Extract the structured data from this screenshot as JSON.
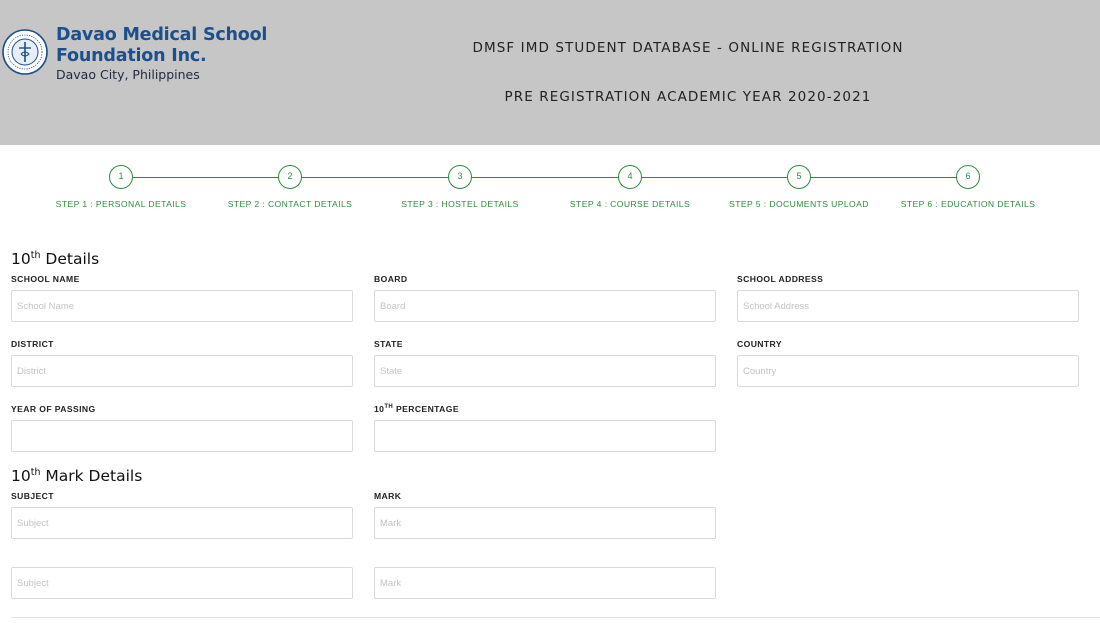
{
  "header": {
    "logo_line1": "Davao Medical School",
    "logo_line2": "Foundation Inc.",
    "logo_line3": "Davao City, Philippines",
    "title": "DMSF IMD STUDENT DATABASE - ONLINE REGISTRATION",
    "subtitle": "PRE REGISTRATION ACADEMIC YEAR 2020-2021",
    "logo_icon": "school-seal-icon",
    "bg_color": "#c6c6c6",
    "brand_color": "#1c4f8c"
  },
  "stepper": {
    "accent_color": "#2e8b3c",
    "steps": [
      {
        "number": "1",
        "label": "STEP 1 : PERSONAL DETAILS"
      },
      {
        "number": "2",
        "label": "STEP 2 : CONTACT DETAILS"
      },
      {
        "number": "3",
        "label": "STEP 3 : HOSTEL DETAILS"
      },
      {
        "number": "4",
        "label": "STEP 4 : COURSE DETAILS"
      },
      {
        "number": "5",
        "label": "STEP 5 : DOCUMENTS UPLOAD"
      },
      {
        "number": "6",
        "label": "STEP 6 : EDUCATION DETAILS"
      }
    ]
  },
  "tenth_details": {
    "title_num": "10",
    "title_sup": "th",
    "title_rest": " Details",
    "school_name": {
      "label": "SCHOOL NAME",
      "placeholder": "School Name",
      "value": ""
    },
    "board": {
      "label": "BOARD",
      "placeholder": "Board",
      "value": ""
    },
    "school_address": {
      "label": "SCHOOL ADDRESS",
      "placeholder": "School Address",
      "value": ""
    },
    "district": {
      "label": "DISTRICT",
      "placeholder": "District",
      "value": ""
    },
    "state": {
      "label": "STATE",
      "placeholder": "State",
      "value": ""
    },
    "country": {
      "label": "COUNTRY",
      "placeholder": "Country",
      "value": ""
    },
    "year_of_passing": {
      "label": "YEAR OF PASSING",
      "placeholder": "",
      "value": ""
    },
    "percentage": {
      "label_num": "10",
      "label_sup": "TH",
      "label_rest": " PERCENTAGE",
      "placeholder": "",
      "value": ""
    }
  },
  "tenth_marks": {
    "title_num": "10",
    "title_sup": "th",
    "title_rest": " Mark Details",
    "subject_label": "SUBJECT",
    "mark_label": "MARK",
    "rows": [
      {
        "subject_placeholder": "Subject",
        "mark_placeholder": "Mark"
      },
      {
        "subject_placeholder": "Subject",
        "mark_placeholder": "Mark"
      }
    ]
  }
}
